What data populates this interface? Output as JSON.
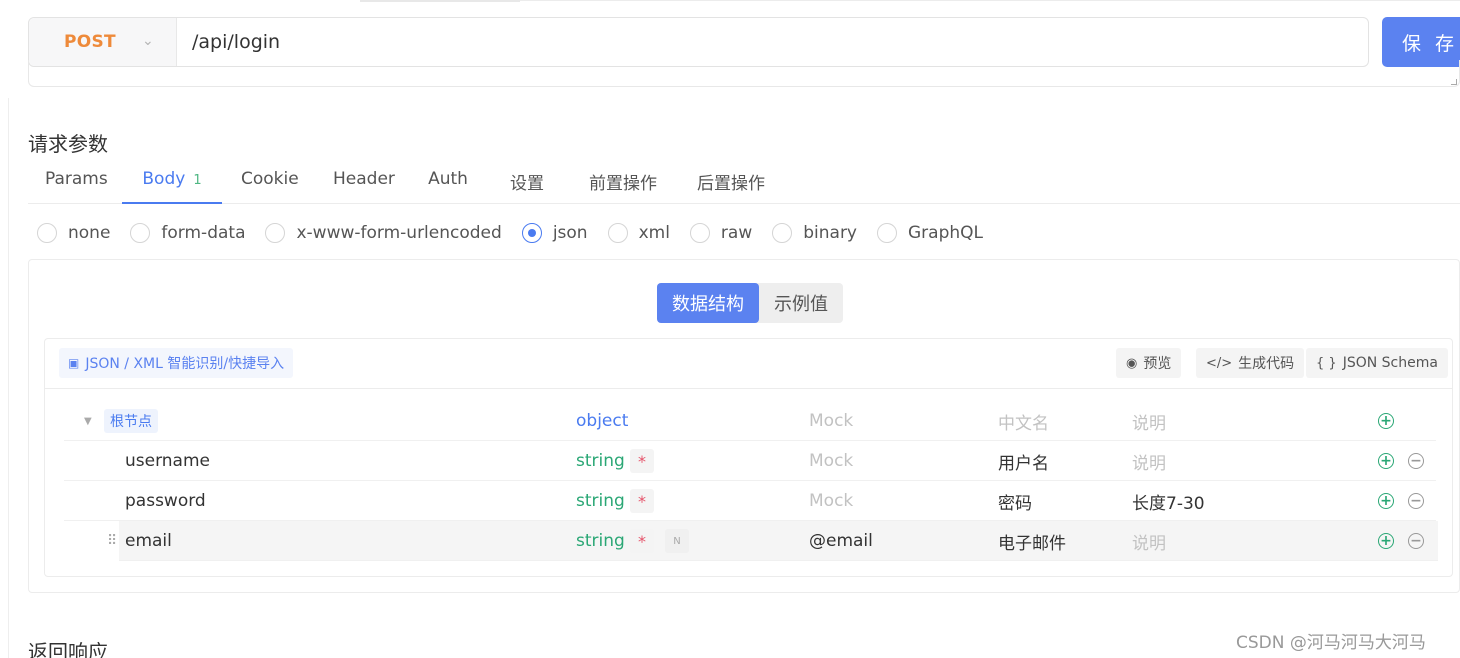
{
  "request": {
    "method": "POST",
    "url": "/api/login",
    "save_label": "保 存"
  },
  "sections": {
    "request_params_title": "请求参数",
    "response_title": "返回响应"
  },
  "tabs": [
    {
      "label": "Params",
      "active": false
    },
    {
      "label": "Body",
      "badge": "1",
      "active": true
    },
    {
      "label": "Cookie",
      "active": false
    },
    {
      "label": "Header",
      "active": false
    },
    {
      "label": "Auth",
      "active": false
    },
    {
      "label": "设置",
      "active": false
    },
    {
      "label": "前置操作",
      "active": false
    },
    {
      "label": "后置操作",
      "active": false
    }
  ],
  "body_types": [
    {
      "label": "none",
      "checked": false
    },
    {
      "label": "form-data",
      "checked": false
    },
    {
      "label": "x-www-form-urlencoded",
      "checked": false
    },
    {
      "label": "json",
      "checked": true
    },
    {
      "label": "xml",
      "checked": false
    },
    {
      "label": "raw",
      "checked": false
    },
    {
      "label": "binary",
      "checked": false
    },
    {
      "label": "GraphQL",
      "checked": false
    }
  ],
  "view_toggle": {
    "structure": "数据结构",
    "example": "示例值",
    "active": "structure"
  },
  "schema_toolbar": {
    "import": "JSON / XML 智能识别/快捷导入",
    "preview": "预览",
    "generate_code": "生成代码",
    "json_schema": "JSON Schema"
  },
  "schema": {
    "root": {
      "name": "根节点",
      "type": "object",
      "mock_placeholder": "Mock",
      "title_placeholder": "中文名",
      "desc_placeholder": "说明"
    },
    "fields": [
      {
        "name": "username",
        "type": "string",
        "required": "*",
        "mock": "",
        "mock_placeholder": "Mock",
        "title": "用户名",
        "desc": "",
        "desc_placeholder": "说明"
      },
      {
        "name": "password",
        "type": "string",
        "required": "*",
        "mock": "",
        "mock_placeholder": "Mock",
        "title": "密码",
        "desc": "长度7-30",
        "desc_placeholder": "说明"
      },
      {
        "name": "email",
        "type": "string",
        "required": "*",
        "nullable": "N",
        "mock": "@email",
        "mock_placeholder": "Mock",
        "title": "电子邮件",
        "desc": "",
        "desc_placeholder": "说明"
      }
    ]
  },
  "watermark": "CSDN @河马河马大河马",
  "colors": {
    "primary": "#5b82f0",
    "method_post": "#ee8a3a",
    "string_type": "#2aa775",
    "required": "#e6546b"
  }
}
